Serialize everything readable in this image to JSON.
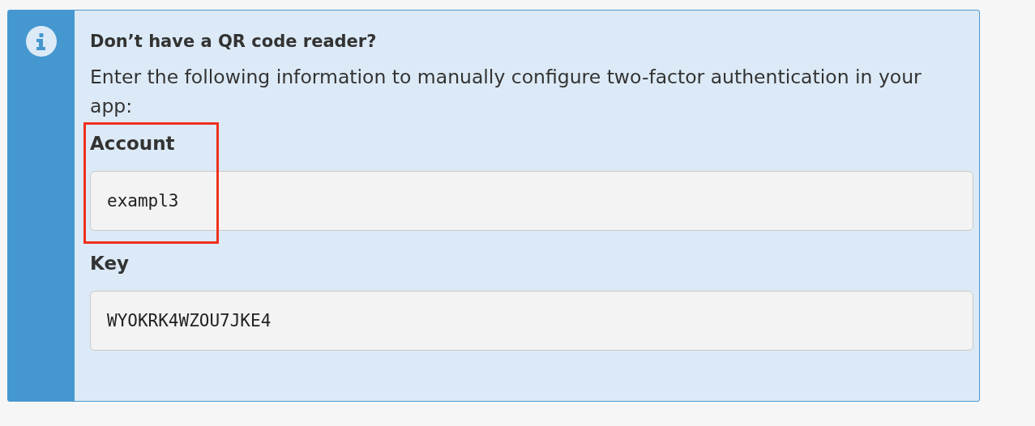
{
  "notice": {
    "title": "Don’t have a QR code reader?",
    "text": "Enter the following information to manually configure two-factor authentication in your app:"
  },
  "fields": [
    {
      "label": "Account",
      "value": "exampl3",
      "highlighted": true
    },
    {
      "label": "Key",
      "value": "WYOKRK4WZOU7JKE4",
      "highlighted": false
    }
  ]
}
